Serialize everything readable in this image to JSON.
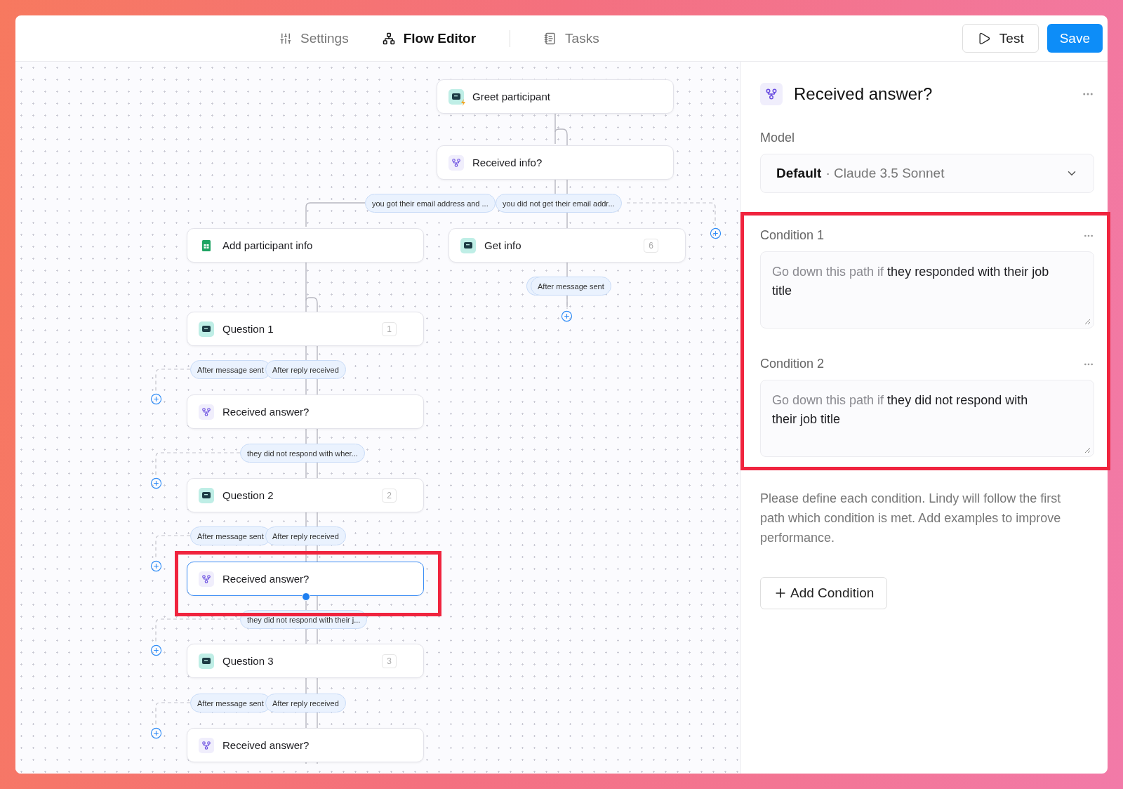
{
  "tabs": [
    {
      "label": "Settings",
      "kind": "sliders",
      "selected": false
    },
    {
      "label": "Flow Editor",
      "kind": "flow",
      "selected": true
    },
    {
      "label": "Tasks",
      "kind": "notes",
      "selected": false
    }
  ],
  "actions": [
    {
      "label": "Test",
      "kind": "secondary"
    },
    {
      "label": "Save",
      "kind": "primary"
    }
  ],
  "flow": {
    "nodes": [
      {
        "kind": "trigger",
        "label": "Greet participant",
        "selected": false,
        "highlighted": false
      },
      {
        "kind": "condition",
        "label": "Received info?",
        "selected": false,
        "highlighted": false
      },
      {
        "kind": "sheet",
        "label": "Add participant info",
        "selected": false,
        "highlighted": false
      },
      {
        "kind": "message",
        "label": "Get info",
        "badge": "6",
        "selected": false,
        "highlighted": false
      },
      {
        "kind": "message",
        "label": "Question 1",
        "badge": "1",
        "selected": false,
        "highlighted": false
      },
      {
        "kind": "condition",
        "label": "Received answer?",
        "selected": false,
        "highlighted": false
      },
      {
        "kind": "message",
        "label": "Question 2",
        "badge": "2",
        "selected": false,
        "highlighted": false
      },
      {
        "kind": "condition",
        "label": "Received answer?",
        "selected": true,
        "highlighted": true
      },
      {
        "kind": "message",
        "label": "Question 3",
        "badge": "3",
        "selected": false,
        "highlighted": false
      },
      {
        "kind": "condition",
        "label": "Received answer?",
        "selected": false,
        "highlighted": false
      }
    ],
    "edge_labels": [
      {
        "text": "you got their email address and ...",
        "stacked": false
      },
      {
        "text": "you did not get their email addr...",
        "stacked": false
      },
      {
        "text": "After message sent",
        "stacked": true
      },
      {
        "text": "After message sent",
        "stacked": false
      },
      {
        "text": "After reply received",
        "stacked": false
      },
      {
        "text": "they did not respond with wher...",
        "stacked": false
      },
      {
        "text": "After message sent",
        "stacked": false
      },
      {
        "text": "After reply received",
        "stacked": false
      },
      {
        "text": "they did not respond with their j...",
        "stacked": false
      },
      {
        "text": "After message sent",
        "stacked": false
      },
      {
        "text": "After reply received",
        "stacked": false
      }
    ]
  },
  "panel": {
    "title": "Received answer?",
    "model_label": "Model",
    "model": {
      "name": "Default",
      "version": "· Claude 3.5 Sonnet"
    },
    "conditions_highlighted": true,
    "conditions": [
      {
        "label": "Condition 1",
        "prefix": "Go down this path if",
        "value": "they responded with their job title"
      },
      {
        "label": "Condition 2",
        "prefix": "Go down this path if",
        "value": "they did not respond with their job title"
      }
    ],
    "help": "Please define each condition. Lindy will follow the first path which condition is met. Add examples to improve performance.",
    "add_button": "Add Condition"
  }
}
